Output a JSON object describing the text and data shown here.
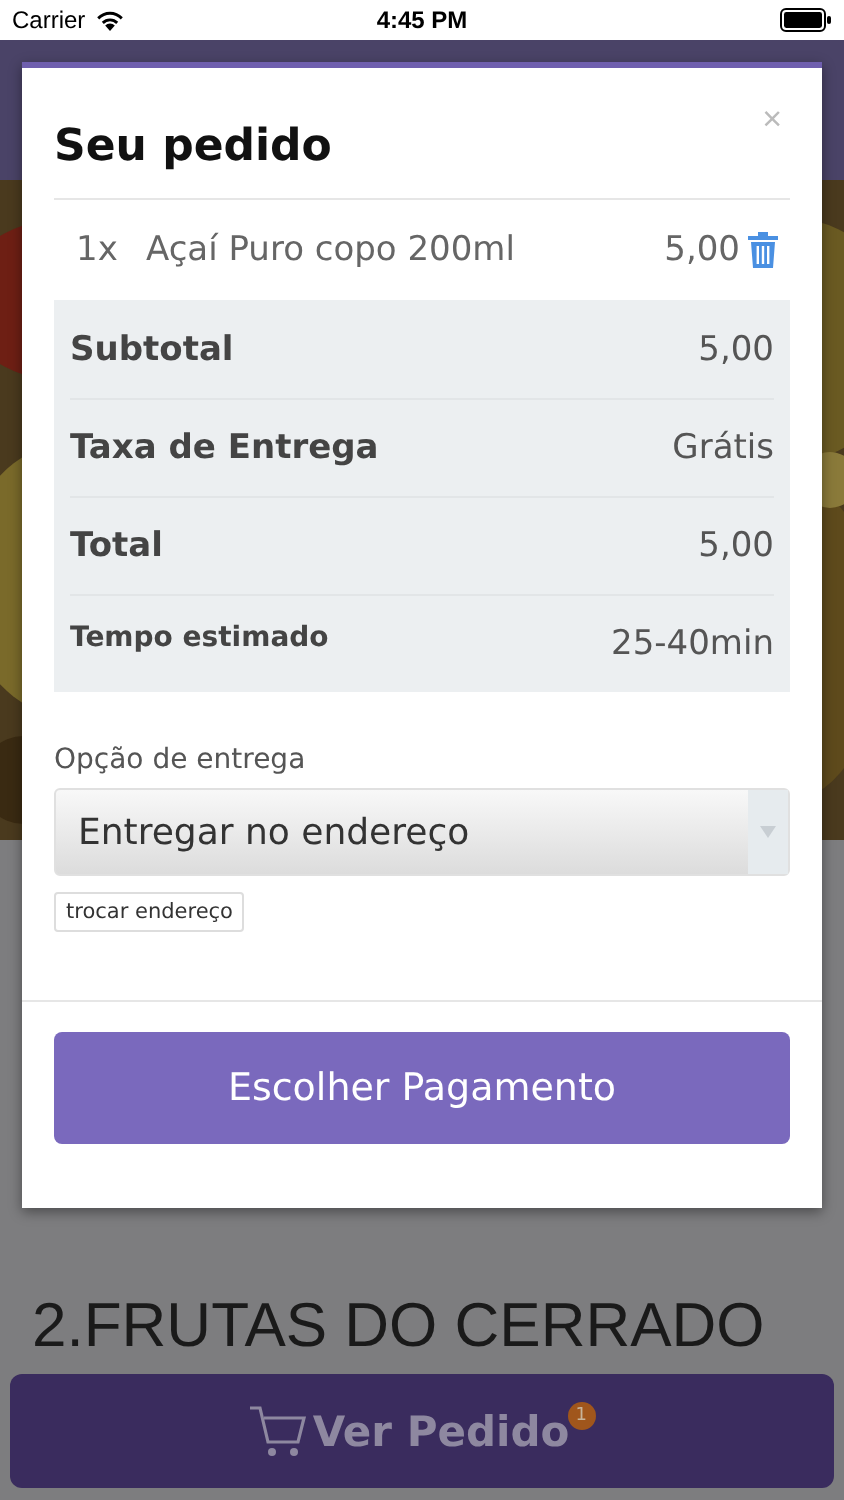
{
  "status_bar": {
    "carrier": "Carrier",
    "time": "4:45 PM"
  },
  "modal": {
    "title": "Seu pedido",
    "close": "×",
    "items": [
      {
        "quantity": "1x",
        "name": "Açaí Puro copo 200ml",
        "price": "5,00"
      }
    ],
    "summary": [
      {
        "kind": "row",
        "label": "Subtotal",
        "value": "5,00"
      },
      {
        "kind": "row",
        "label": "Taxa de Entrega",
        "value": "Grátis"
      },
      {
        "kind": "row",
        "label": "Total",
        "value": "5,00"
      },
      {
        "kind": "note",
        "label": "Tempo estimado",
        "value": "25-40min"
      }
    ],
    "delivery": {
      "label": "Opção de entrega",
      "value": "Entregar no endereço"
    },
    "change_address": "trocar endereço",
    "pay_button": "Escolher Pagamento"
  },
  "page": {
    "section_title": "2.FRUTAS DO CERRADO",
    "cart_button": {
      "label": "Ver Pedido",
      "badge": "1"
    }
  }
}
